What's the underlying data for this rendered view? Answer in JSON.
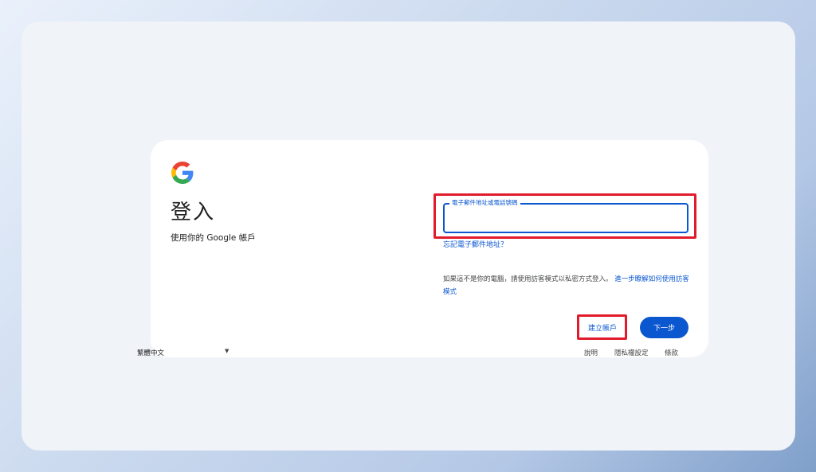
{
  "signin": {
    "title": "登入",
    "subtitle": "使用你的 Google 帳戶",
    "email_label": "電子郵件地址或電話號碼",
    "email_value": "",
    "forgot_email": "忘記電子郵件地址？",
    "guest_text": "如果這不是你的電腦，請使用訪客模式以私密方式登入。",
    "guest_link": "進一步瞭解如何使用訪客模式",
    "create_account": "建立帳戶",
    "next": "下一步"
  },
  "footer": {
    "language": "繁體中文",
    "help": "說明",
    "privacy": "隱私權設定",
    "terms": "條款"
  },
  "colors": {
    "accent": "#0b57d0",
    "highlight": "#e11b2b"
  },
  "icons": {
    "logo": "google-g-icon",
    "dropdown": "caret-down-icon"
  }
}
